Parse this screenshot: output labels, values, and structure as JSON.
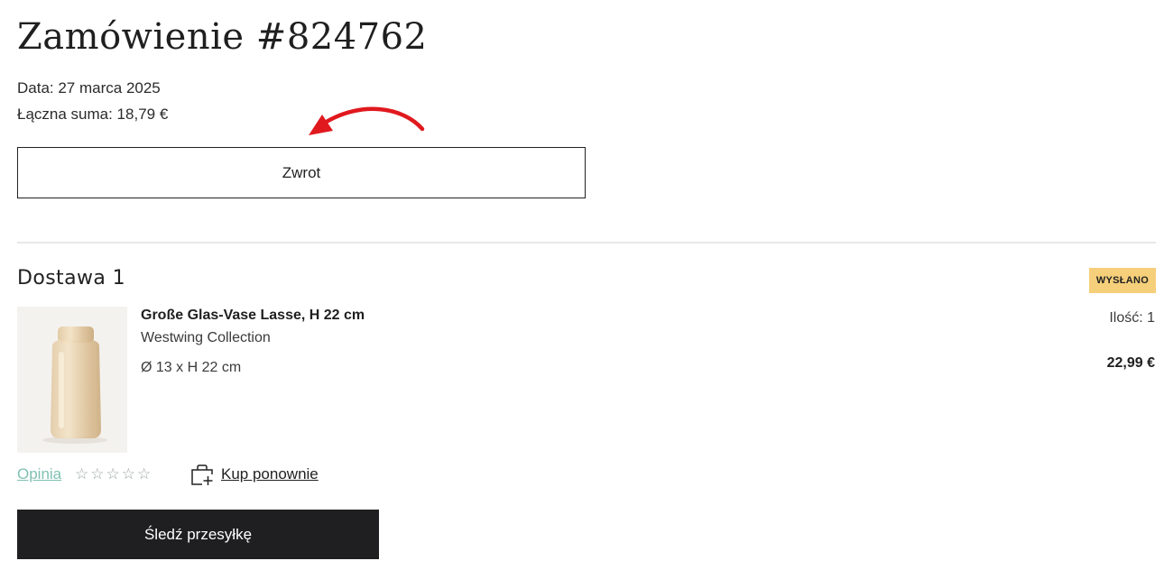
{
  "order": {
    "title": "Zamówienie #824762",
    "date": "Data: 27 marca 2025",
    "total": "Łączna suma: 18,79 €",
    "return_button": "Zwrot"
  },
  "delivery": {
    "title": "Dostawa 1",
    "status": "WYSŁANO",
    "status_color": "#f5cf7a",
    "item": {
      "name": "Große Glas-Vase Lasse, H 22 cm",
      "brand": "Westwing Collection",
      "dimensions": "Ø 13 x H 22 cm",
      "quantity": "Ilość: 1",
      "price": "22,99 €"
    },
    "review_label": "Opinia",
    "rating": {
      "value": 0,
      "max": 5
    },
    "rebuy_label": "Kup ponownie",
    "track_button": "Śledź przesyłkę"
  },
  "colors": {
    "accent_link": "#7fc1b2",
    "annotation_arrow": "#e0191e",
    "primary_button": "#1f1f21"
  },
  "icons": {
    "arrow": "annotation-arrow-icon",
    "star": "star-outline-icon",
    "rebuy": "bag-plus-icon"
  }
}
